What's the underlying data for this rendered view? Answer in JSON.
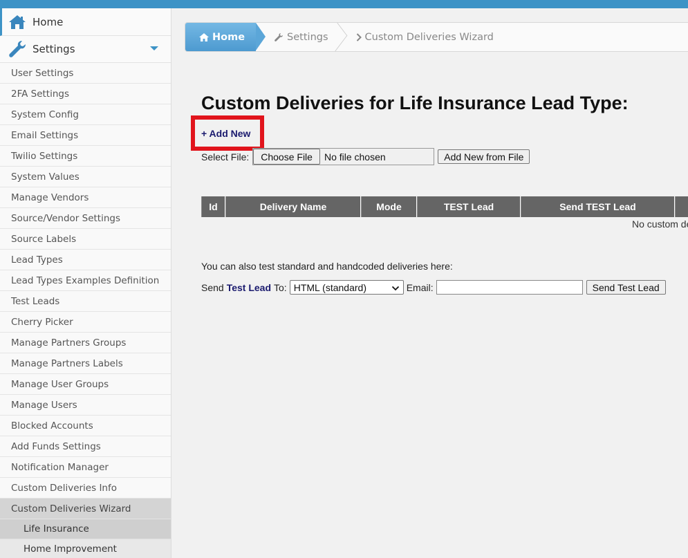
{
  "sidebar": {
    "home": "Home",
    "settings": "Settings",
    "items": [
      "User Settings",
      "2FA Settings",
      "System Config",
      "Email Settings",
      "Twilio Settings",
      "System Values",
      "Manage Vendors",
      "Source/Vendor Settings",
      "Source Labels",
      "Lead Types",
      "Lead Types Examples Definition",
      "Test Leads",
      "Cherry Picker",
      "Manage Partners Groups",
      "Manage Partners Labels",
      "Manage User Groups",
      "Manage Users",
      "Blocked Accounts",
      "Add Funds Settings",
      "Notification Manager",
      "Custom Deliveries Info",
      "Custom Deliveries Wizard"
    ],
    "subitems": [
      "Life Insurance",
      "Home Improvement"
    ]
  },
  "breadcrumb": {
    "home": "Home",
    "settings": "Settings",
    "current": "Custom Deliveries Wizard"
  },
  "main": {
    "title": "Custom Deliveries for Life Insurance Lead Type:",
    "add_new": "+ Add New",
    "select_file_label": "Select File:",
    "choose_file": "Choose File",
    "file_status": "No file chosen",
    "add_new_from_file": "Add New from File",
    "columns": [
      "Id",
      "Delivery Name",
      "Mode",
      "TEST Lead",
      "Send TEST Lead",
      ""
    ],
    "empty_message": "No custom de",
    "info_text": "You can also test standard and handcoded deliveries here:",
    "send_prefix": "Send",
    "test_lead_link": "Test Lead",
    "to_label": "To:",
    "delivery_select": "HTML (standard)",
    "email_label": "Email:",
    "email_value": "",
    "send_test_lead": "Send Test Lead"
  },
  "colors": {
    "topbar": "#3d93c6",
    "highlight": "#e1141c",
    "grid_header": "#656565"
  }
}
